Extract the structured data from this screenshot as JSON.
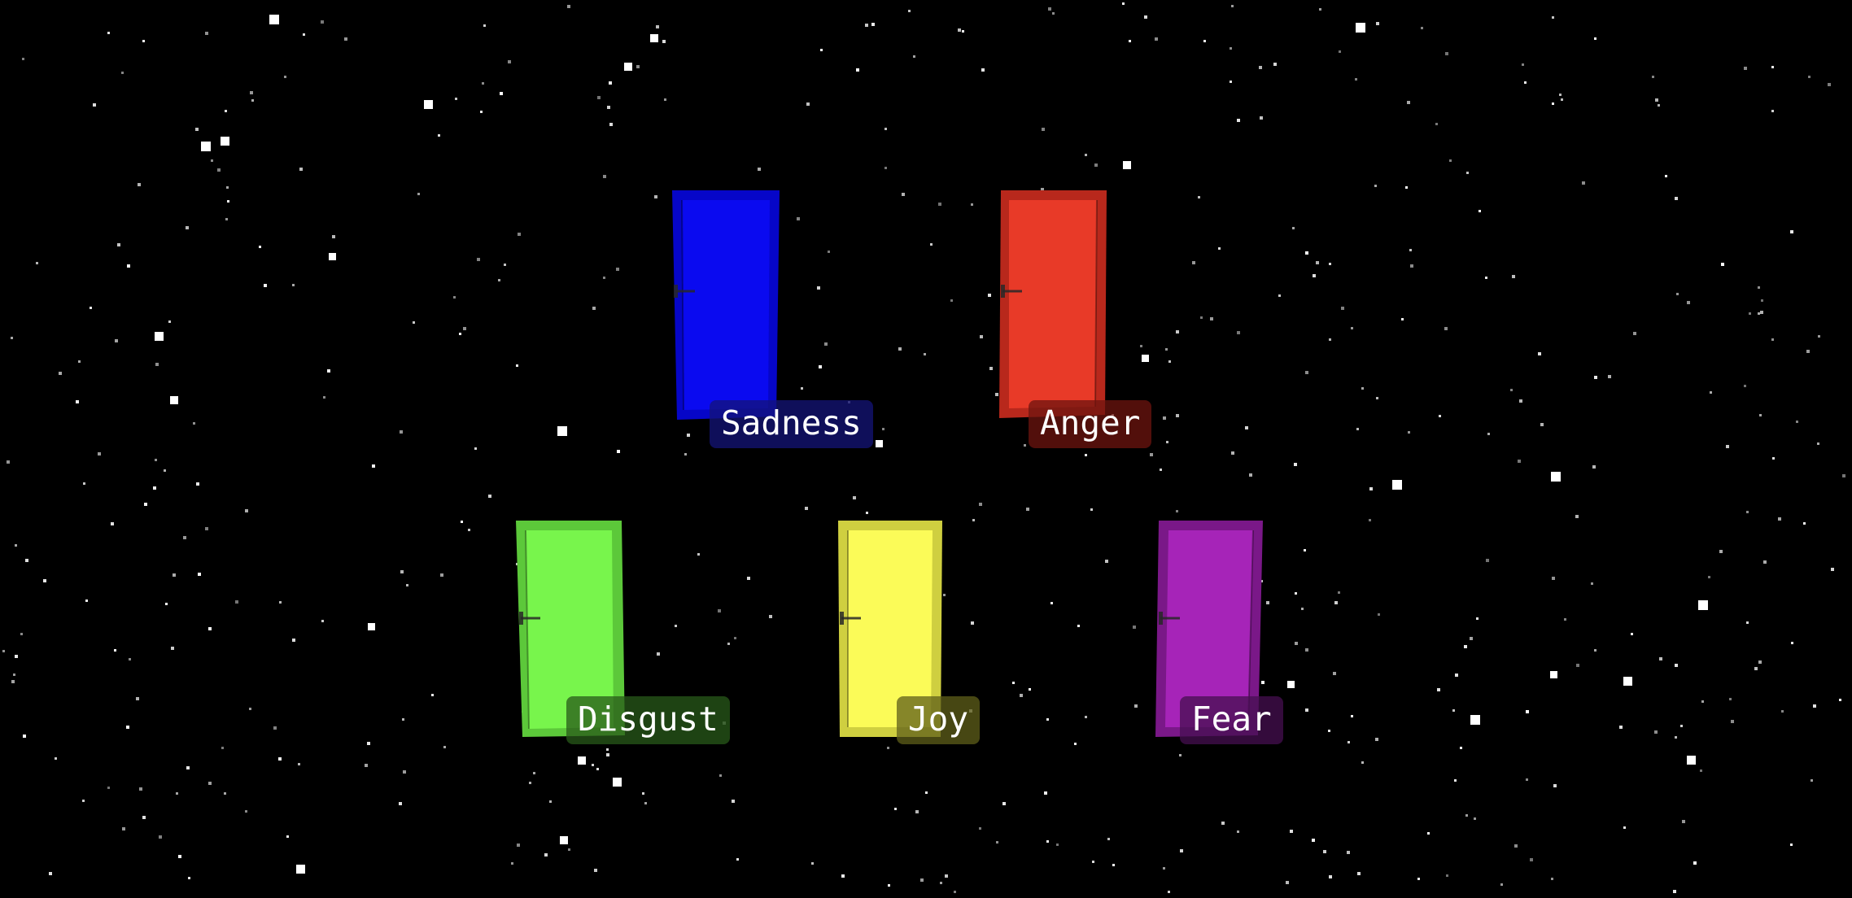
{
  "doors": [
    {
      "id": "sadness",
      "label": "Sadness",
      "color": "#0a0af0",
      "frame": "#0606c8",
      "label_bg": "rgba(20,20,120,0.75)"
    },
    {
      "id": "anger",
      "label": "Anger",
      "color": "#e83a28",
      "frame": "#b8281c",
      "label_bg": "rgba(110,20,15,0.75)"
    },
    {
      "id": "disgust",
      "label": "Disgust",
      "color": "#78f54c",
      "frame": "#5cc83a",
      "label_bg": "rgba(40,90,25,0.75)"
    },
    {
      "id": "joy",
      "label": "Joy",
      "color": "#fbfb58",
      "frame": "#cfcf40",
      "label_bg": "rgba(95,95,25,0.75)"
    },
    {
      "id": "fear",
      "label": "Fear",
      "color": "#a624b8",
      "frame": "#7a1888",
      "label_bg": "rgba(70,15,80,0.75)"
    }
  ],
  "background": {
    "color": "#000000",
    "star_color": "#ffffff"
  }
}
